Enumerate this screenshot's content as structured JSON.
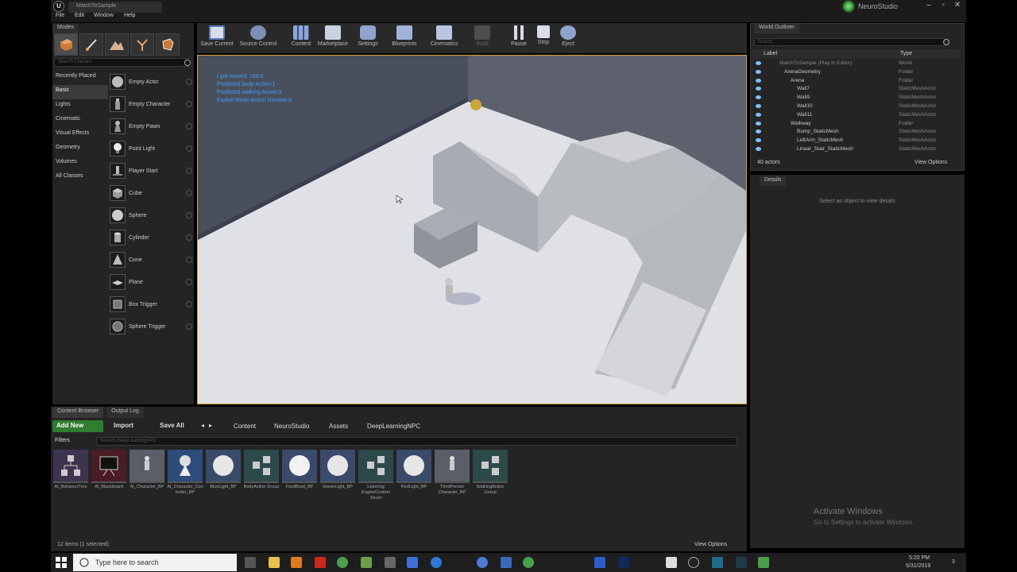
{
  "window": {
    "doc_tab": "MatchToSample",
    "brand": "NeuroStudio"
  },
  "menu": [
    "File",
    "Edit",
    "Window",
    "Help"
  ],
  "modes": {
    "tab": "Modes",
    "search_placeholder": "Search Classes",
    "categories": [
      "Recently Placed",
      "Basic",
      "Lights",
      "Cinematic",
      "Visual Effects",
      "Geometry",
      "Volumes",
      "All Classes"
    ],
    "active_category": "Basic",
    "items": [
      "Empty Actor",
      "Empty Character",
      "Empty Pawn",
      "Point Light",
      "Player Start",
      "Cube",
      "Sphere",
      "Cylinder",
      "Cone",
      "Plane",
      "Box Trigger",
      "Sphere Trigger"
    ]
  },
  "toolbar": {
    "buttons": [
      "Save Current",
      "Source Control",
      "Content",
      "Marketplace",
      "Settings",
      "Blueprints",
      "Cinematics",
      "Build",
      "Pause",
      "Stop",
      "Eject"
    ]
  },
  "viewport": {
    "debug": [
      "I got reward: 100.0",
      "Predicted body Action:1",
      "Predicted walking Action:3",
      "Exploit Mode Action Number:0"
    ]
  },
  "outliner": {
    "tab": "World Outliner",
    "search_placeholder": "Search...",
    "col_label": "Label",
    "col_type": "Type",
    "rows": [
      {
        "label": "MatchToSample (Play In Editor)",
        "type": "World"
      },
      {
        "label": "ArenaGeometry",
        "type": "Folder"
      },
      {
        "label": "Arena",
        "type": "Folder"
      },
      {
        "label": "Wall7",
        "type": "StaticMeshActor"
      },
      {
        "label": "Wall9",
        "type": "StaticMeshActor"
      },
      {
        "label": "Wall10",
        "type": "StaticMeshActor"
      },
      {
        "label": "Wall11",
        "type": "StaticMeshActor"
      },
      {
        "label": "Walkway",
        "type": "Folder"
      },
      {
        "label": "Bump_StaticMesh",
        "type": "StaticMeshActor"
      },
      {
        "label": "LeftArm_StaticMesh",
        "type": "StaticMeshActor"
      },
      {
        "label": "Linear_Stair_StaticMesh",
        "type": "StaticMeshActor"
      }
    ],
    "count": "40 actors",
    "view_options": "View Options"
  },
  "details": {
    "tab": "Details",
    "message": "Select an object to view details"
  },
  "watermark": {
    "title": "Activate Windows",
    "subtitle": "Go to Settings to activate Windows."
  },
  "content_browser": {
    "tabs": [
      "Content Browser",
      "Output Log"
    ],
    "add_new": "Add New",
    "import": "Import",
    "save_all": "Save All",
    "path": [
      "Content",
      "NeuroStudio",
      "Assets",
      "DeepLearningNPC"
    ],
    "filters": "Filters",
    "search_placeholder": "Search DeepLearningNPC",
    "assets": [
      {
        "name": "AI_BehaviorTree",
        "kind": "tree"
      },
      {
        "name": "AI_Blackboard",
        "kind": "board"
      },
      {
        "name": "AI_Character_BP",
        "kind": "mannequin"
      },
      {
        "name": "AI_Character_Controller_BP",
        "kind": "controller"
      },
      {
        "name": "BlueLight_BP",
        "kind": "sphere"
      },
      {
        "name": "BodyAction Group",
        "kind": "struct"
      },
      {
        "name": "FoodBowl_BP",
        "kind": "sphere"
      },
      {
        "name": "GreenLight_BP",
        "kind": "sphere"
      },
      {
        "name": "Learning EngineCustom Struct",
        "kind": "struct"
      },
      {
        "name": "RedLight_BP",
        "kind": "sphere"
      },
      {
        "name": "ThirdPerson Character_BP",
        "kind": "mannequin"
      },
      {
        "name": "WalkingAction Group",
        "kind": "struct"
      }
    ],
    "status": "12 items (1 selected)",
    "view_options": "View Options"
  },
  "taskbar": {
    "search_placeholder": "Type here to search",
    "time": "5:20 PM",
    "date": "5/31/2019",
    "notifications": "3"
  }
}
